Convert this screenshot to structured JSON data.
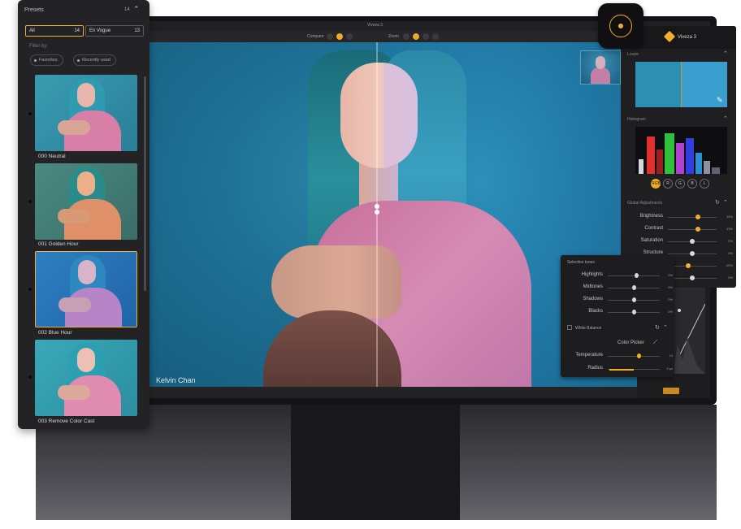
{
  "app": {
    "window_title": "Viveza 3",
    "compare_label": "Compare",
    "zoom_label": "Zoom"
  },
  "photo": {
    "credit": "Kelvin Chan"
  },
  "presets": {
    "title": "Presets",
    "count": "14",
    "collections": [
      {
        "label": "All",
        "count": "14"
      },
      {
        "label": "En Vogue",
        "count": "13"
      }
    ],
    "filter_label": "Filter by:",
    "filters": [
      "Favorites",
      "Recently used"
    ],
    "items": [
      {
        "label": "000 Neutral"
      },
      {
        "label": "001 Golden Hour"
      },
      {
        "label": "002 Blue Hour"
      },
      {
        "label": "003 Remove Color Cast"
      }
    ]
  },
  "right_panel": {
    "title": "Viveza 3",
    "loupe_label": "Loupe",
    "histogram_label": "Histogram",
    "channels": [
      "RGB",
      "R",
      "G",
      "B",
      "L"
    ],
    "active_channel": "RGB",
    "global_label": "Global Adjustments",
    "adjustments": [
      {
        "label": "Brightness",
        "value": "14%",
        "level": 0.62
      },
      {
        "label": "Contrast",
        "value": "13%",
        "level": 0.61
      },
      {
        "label": "Saturation",
        "value": "0%",
        "level": 0.5
      },
      {
        "label": "Structure",
        "value": "0%",
        "level": 0.5
      },
      {
        "label": "",
        "value": "-25%",
        "level": 0.42
      },
      {
        "label": "",
        "value": "0%",
        "level": 0.5
      },
      {
        "label": "",
        "value": "0%",
        "level": 0.5
      }
    ]
  },
  "selective": {
    "title": "Selective tones",
    "rows": [
      {
        "label": "Highlights",
        "value": "0%",
        "level": 0.55
      },
      {
        "label": "Midtones",
        "value": "0%",
        "level": 0.5
      },
      {
        "label": "Shadows",
        "value": "0%",
        "level": 0.5
      },
      {
        "label": "Blacks",
        "value": "0%",
        "level": 0.5
      }
    ],
    "white_balance_label": "White Balance",
    "color_picker_label": "Color Picker",
    "temperature_label": "Temperature",
    "temperature_value": "10",
    "temperature_level": 0.6,
    "radius_label": "Radius",
    "radius_value": "0 px"
  },
  "colors": {
    "accent": "#f0b030",
    "panel_bg": "#232326"
  }
}
